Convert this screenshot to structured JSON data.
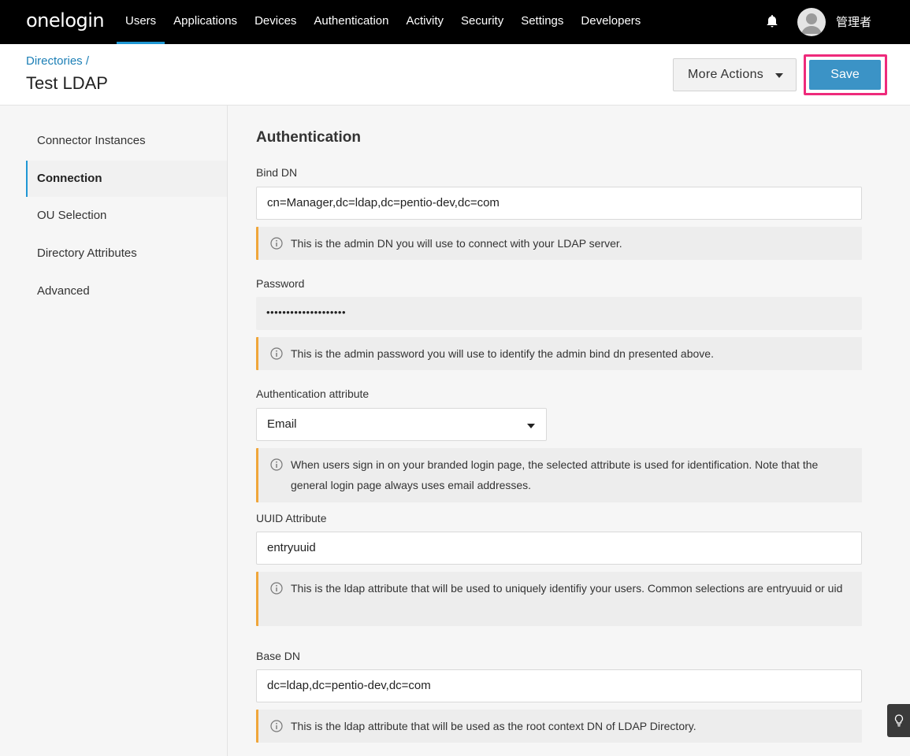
{
  "brand": {
    "logo": "onelogin"
  },
  "nav": {
    "items": [
      {
        "label": "Users"
      },
      {
        "label": "Applications"
      },
      {
        "label": "Devices"
      },
      {
        "label": "Authentication"
      },
      {
        "label": "Activity"
      },
      {
        "label": "Security"
      },
      {
        "label": "Settings"
      },
      {
        "label": "Developers"
      }
    ],
    "active": "Users",
    "username": "管理者"
  },
  "header": {
    "breadcrumb": "Directories /",
    "title": "Test LDAP",
    "more_actions_label": "More Actions",
    "save_label": "Save"
  },
  "sidebar": {
    "items": [
      {
        "label": "Connector Instances"
      },
      {
        "label": "Connection"
      },
      {
        "label": "OU Selection"
      },
      {
        "label": "Directory Attributes"
      },
      {
        "label": "Advanced"
      }
    ],
    "active": "Connection"
  },
  "main": {
    "section_title": "Authentication",
    "fields": {
      "bind_dn": {
        "label": "Bind DN",
        "value": "cn=Manager,dc=ldap,dc=pentio-dev,dc=com",
        "hint": "This is the admin DN you will use to connect with your LDAP server."
      },
      "password": {
        "label": "Password",
        "value": "••••••••••••••••••••",
        "hint": "This is the admin password you will use to identify the admin bind dn presented above."
      },
      "auth_attribute": {
        "label": "Authentication attribute",
        "value": "Email",
        "hint": "When users sign in on your branded login page, the selected attribute is used for identification. Note that the general login page always uses email addresses."
      },
      "uuid_attribute": {
        "label": "UUID Attribute",
        "value": "entryuuid",
        "hint": "This is the ldap attribute that will be used to uniquely identifiy your users. Common selections are entryuuid or uid"
      },
      "base_dn": {
        "label": "Base DN",
        "value": "dc=ldap,dc=pentio-dev,dc=com",
        "hint": "This is the ldap attribute that will be used as the root context DN of LDAP Directory."
      }
    }
  },
  "colors": {
    "accent": "#1f97d4",
    "save_button": "#3b93c6",
    "highlight_outline": "#ee2a7b",
    "hint_border": "#f0a63a",
    "topnav_bg": "#000000"
  },
  "icons": [
    "bell-icon",
    "avatar-icon",
    "chevron-down-icon",
    "info-icon",
    "lightbulb-icon"
  ]
}
